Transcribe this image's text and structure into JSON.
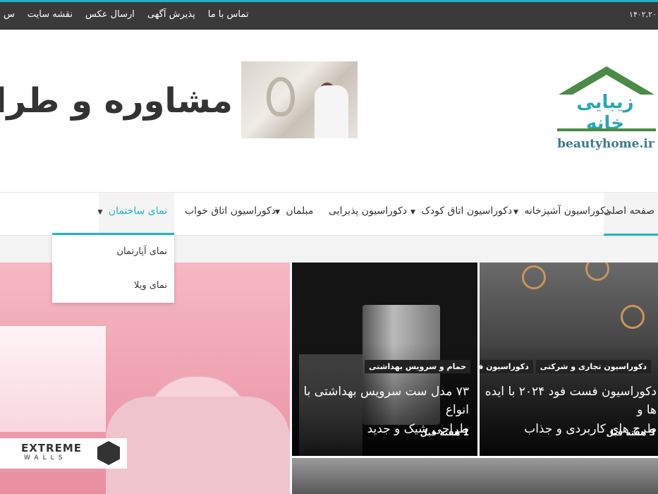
{
  "topbar": {
    "date": "۱۴۰۲,۲۰",
    "links": [
      "تماس با ما",
      "پذیرش آگهی",
      "ارسال عکس",
      "نقشه سایت",
      "س"
    ]
  },
  "header": {
    "logo_text": "زیبایی خانه",
    "logo_domain": "beautyhome.ir",
    "banner_text": "مشاوره و طراحی رایگ"
  },
  "nav": {
    "items": [
      "صفحه اصلی",
      "دکوراسیون آشپزخانه",
      "دکوراسیون اتاق کودک",
      "دکوراسیون پذیرایی",
      "مبلمان",
      "دکوراسیون اتاق خواب",
      "نمای ساختمان"
    ],
    "caret": "▼"
  },
  "dropdown": {
    "items": [
      "نمای آپارتمان",
      "نمای ویلا"
    ]
  },
  "cards": {
    "right": {
      "tags": [
        "دکوراسیون تجاری و شرکتی",
        "دکوراسیون فروشگاه"
      ],
      "title_line1": "دکوراسیون فست فود ۲۰۲۴ با ایده ها و",
      "title_line2": "طرح های کاربردی و جذاب",
      "time": "3 هفته قبل"
    },
    "middle": {
      "tags": [
        "حمام و سرویس بهداشتی"
      ],
      "title_line1": "۷۳ مدل ست سرویس بهداشتی با انواع",
      "title_line2": "طراحی شیک و جدید",
      "time": "1 هفته قبل"
    },
    "left": {
      "logo_main": "EXTREME",
      "logo_sub": "WALLS"
    }
  },
  "colors": {
    "accent": "#21b3c5",
    "topbar": "#3a3a3a",
    "logo_green": "#4a8b47"
  }
}
